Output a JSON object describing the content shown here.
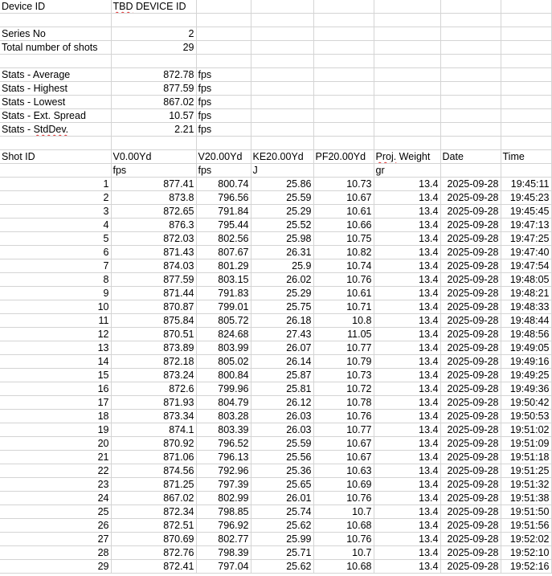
{
  "device": {
    "id_label": "Device ID",
    "id_value_parts": [
      "TBD",
      " DEVICE ID"
    ]
  },
  "series": {
    "label": "Series No",
    "value": "2"
  },
  "total": {
    "label": "Total number of shots",
    "value": "29"
  },
  "stats": [
    {
      "label_parts": [
        "Stats - Average",
        ""
      ],
      "value": "872.78",
      "unit": "fps"
    },
    {
      "label_parts": [
        "Stats - Highest",
        ""
      ],
      "value": "877.59",
      "unit": "fps"
    },
    {
      "label_parts": [
        "Stats - Lowest",
        ""
      ],
      "value": "867.02",
      "unit": "fps"
    },
    {
      "label_parts": [
        "Stats - Ext. Spread",
        ""
      ],
      "value": "10.57",
      "unit": "fps"
    },
    {
      "label_parts": [
        "Stats - ",
        "StdDev."
      ],
      "value": "2.21",
      "unit": "fps"
    }
  ],
  "table": {
    "headers": [
      "Shot ID",
      "V0.00Yd",
      "V20.00Yd",
      "KE20.00Yd",
      "PF20.00Yd",
      "Proj. Weight",
      "Date",
      "Time"
    ],
    "weight_header_parts": [
      "Proj.",
      " Weight"
    ],
    "units": [
      "",
      "fps",
      "fps",
      "J",
      "",
      "gr",
      "",
      ""
    ],
    "rows": [
      [
        "1",
        "877.41",
        "800.74",
        "25.86",
        "10.73",
        "13.4",
        "2025-09-28",
        "19:45:11"
      ],
      [
        "2",
        "873.8",
        "796.56",
        "25.59",
        "10.67",
        "13.4",
        "2025-09-28",
        "19:45:23"
      ],
      [
        "3",
        "872.65",
        "791.84",
        "25.29",
        "10.61",
        "13.4",
        "2025-09-28",
        "19:45:45"
      ],
      [
        "4",
        "876.3",
        "795.44",
        "25.52",
        "10.66",
        "13.4",
        "2025-09-28",
        "19:47:13"
      ],
      [
        "5",
        "872.03",
        "802.56",
        "25.98",
        "10.75",
        "13.4",
        "2025-09-28",
        "19:47:25"
      ],
      [
        "6",
        "871.43",
        "807.67",
        "26.31",
        "10.82",
        "13.4",
        "2025-09-28",
        "19:47:40"
      ],
      [
        "7",
        "874.03",
        "801.29",
        "25.9",
        "10.74",
        "13.4",
        "2025-09-28",
        "19:47:54"
      ],
      [
        "8",
        "877.59",
        "803.15",
        "26.02",
        "10.76",
        "13.4",
        "2025-09-28",
        "19:48:05"
      ],
      [
        "9",
        "871.44",
        "791.83",
        "25.29",
        "10.61",
        "13.4",
        "2025-09-28",
        "19:48:21"
      ],
      [
        "10",
        "870.87",
        "799.01",
        "25.75",
        "10.71",
        "13.4",
        "2025-09-28",
        "19:48:33"
      ],
      [
        "11",
        "875.84",
        "805.72",
        "26.18",
        "10.8",
        "13.4",
        "2025-09-28",
        "19:48:44"
      ],
      [
        "12",
        "870.51",
        "824.68",
        "27.43",
        "11.05",
        "13.4",
        "2025-09-28",
        "19:48:56"
      ],
      [
        "13",
        "873.89",
        "803.99",
        "26.07",
        "10.77",
        "13.4",
        "2025-09-28",
        "19:49:05"
      ],
      [
        "14",
        "872.18",
        "805.02",
        "26.14",
        "10.79",
        "13.4",
        "2025-09-28",
        "19:49:16"
      ],
      [
        "15",
        "873.24",
        "800.84",
        "25.87",
        "10.73",
        "13.4",
        "2025-09-28",
        "19:49:25"
      ],
      [
        "16",
        "872.6",
        "799.96",
        "25.81",
        "10.72",
        "13.4",
        "2025-09-28",
        "19:49:36"
      ],
      [
        "17",
        "871.93",
        "804.79",
        "26.12",
        "10.78",
        "13.4",
        "2025-09-28",
        "19:50:42"
      ],
      [
        "18",
        "873.34",
        "803.28",
        "26.03",
        "10.76",
        "13.4",
        "2025-09-28",
        "19:50:53"
      ],
      [
        "19",
        "874.1",
        "803.39",
        "26.03",
        "10.77",
        "13.4",
        "2025-09-28",
        "19:51:02"
      ],
      [
        "20",
        "870.92",
        "796.52",
        "25.59",
        "10.67",
        "13.4",
        "2025-09-28",
        "19:51:09"
      ],
      [
        "21",
        "871.06",
        "796.13",
        "25.56",
        "10.67",
        "13.4",
        "2025-09-28",
        "19:51:18"
      ],
      [
        "22",
        "874.56",
        "792.96",
        "25.36",
        "10.63",
        "13.4",
        "2025-09-28",
        "19:51:25"
      ],
      [
        "23",
        "871.25",
        "797.39",
        "25.65",
        "10.69",
        "13.4",
        "2025-09-28",
        "19:51:32"
      ],
      [
        "24",
        "867.02",
        "802.99",
        "26.01",
        "10.76",
        "13.4",
        "2025-09-28",
        "19:51:38"
      ],
      [
        "25",
        "872.34",
        "798.85",
        "25.74",
        "10.7",
        "13.4",
        "2025-09-28",
        "19:51:50"
      ],
      [
        "26",
        "872.51",
        "796.92",
        "25.62",
        "10.68",
        "13.4",
        "2025-09-28",
        "19:51:56"
      ],
      [
        "27",
        "870.69",
        "802.77",
        "25.99",
        "10.76",
        "13.4",
        "2025-09-28",
        "19:52:02"
      ],
      [
        "28",
        "872.76",
        "798.39",
        "25.71",
        "10.7",
        "13.4",
        "2025-09-28",
        "19:52:10"
      ],
      [
        "29",
        "872.41",
        "797.04",
        "25.62",
        "10.68",
        "13.4",
        "2025-09-28",
        "19:52:16"
      ]
    ]
  },
  "colors": {
    "gridline": "#d4d4d4",
    "spellcheck": "#e03030"
  }
}
